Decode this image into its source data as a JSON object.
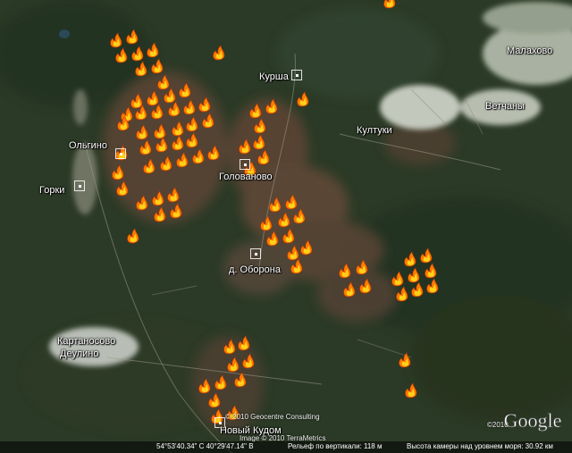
{
  "map": {
    "places": [
      {
        "id": "malakhovo",
        "name": "Малахово"
      },
      {
        "id": "kursha",
        "name": "Курша"
      },
      {
        "id": "vetchany",
        "name": "Ветчаны"
      },
      {
        "id": "kultuki",
        "name": "Култуки"
      },
      {
        "id": "olgino",
        "name": "Ольгино"
      },
      {
        "id": "gorki",
        "name": "Горки"
      },
      {
        "id": "golovanovo",
        "name": "Голованово"
      },
      {
        "id": "oborona",
        "name": "д. Оборона"
      },
      {
        "id": "kartanosovo",
        "name": "Картаносово"
      },
      {
        "id": "deulino",
        "name": "Деулино"
      },
      {
        "id": "novy-kudom",
        "name": "Новый Кудом"
      }
    ],
    "fire_marker_icon": "fire-icon",
    "colors": {
      "forest": "#2b3a26",
      "burn": "#6b4a3a",
      "urban": "#c9cdc6",
      "fire_outer": "#ff7a00",
      "fire_inner": "#ffd21a"
    }
  },
  "credits": {
    "geocentre": "© 2010 Geocentre Consulting",
    "image": "Image © 2010 TerraMetrics",
    "year": "©2010",
    "logo": "Google"
  },
  "status": {
    "coords": "54°53'40.34\" С  40°29'47.14\" В",
    "elevation": "Рельеф по вертикали:  118 м",
    "eye_alt": "Высота камеры над уровнем моря:   30.92 км"
  }
}
